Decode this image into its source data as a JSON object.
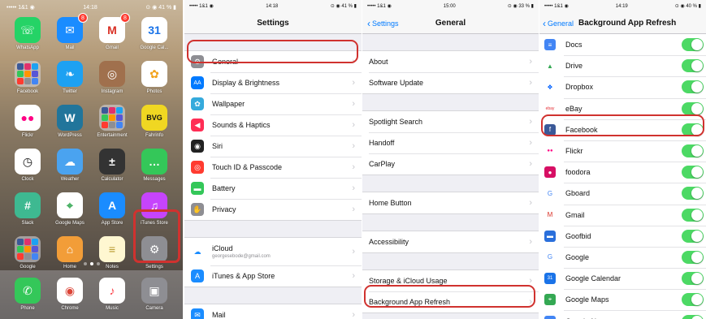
{
  "home": {
    "status": {
      "carrier": "••••• 1&1 ◉",
      "time": "14:18",
      "battery": "⊙ ◉ 41 % ▮"
    },
    "apps": [
      {
        "label": "WhatsApp",
        "icon": "whatsapp-icon",
        "color": "#25d366",
        "glyph": "☏"
      },
      {
        "label": "Mail",
        "icon": "mail-icon",
        "color": "#1a8cff",
        "glyph": "✉",
        "badge": "8"
      },
      {
        "label": "Gmail",
        "icon": "gmail-icon",
        "color": "#ffffff",
        "glyph": "M",
        "badge": "8",
        "fg": "#d93025"
      },
      {
        "label": "Google Cal...",
        "icon": "google-calendar-icon",
        "color": "#ffffff",
        "glyph": "31",
        "fg": "#1a73e8"
      },
      {
        "label": "Facebook",
        "icon": "facebook-folder-icon",
        "folder": true
      },
      {
        "label": "Twitter",
        "icon": "twitter-icon",
        "color": "#1da1f2",
        "glyph": "❧"
      },
      {
        "label": "Instagram",
        "icon": "instagram-icon",
        "color": "#a0704d",
        "glyph": "◎"
      },
      {
        "label": "Photos",
        "icon": "photos-icon",
        "color": "#ffffff",
        "glyph": "✿",
        "fg": "#f2a21a"
      },
      {
        "label": "Flickr",
        "icon": "flickr-icon",
        "color": "#ffffff",
        "glyph": "●●",
        "fg": "#ff0084"
      },
      {
        "label": "WordPress",
        "icon": "wordpress-icon",
        "color": "#21759b",
        "glyph": "W"
      },
      {
        "label": "Entertainment",
        "icon": "entertainment-folder-icon",
        "folder": true
      },
      {
        "label": "Fahrinfo",
        "icon": "bvg-icon",
        "color": "#f0d722",
        "glyph": "BVG",
        "fg": "#111111"
      },
      {
        "label": "Clock",
        "icon": "clock-icon",
        "color": "#ffffff",
        "glyph": "◷",
        "fg": "#111111"
      },
      {
        "label": "Weather",
        "icon": "weather-icon",
        "color": "#4aa3f0",
        "glyph": "☁"
      },
      {
        "label": "Calculator",
        "icon": "calculator-icon",
        "color": "#333333",
        "glyph": "±"
      },
      {
        "label": "Messages",
        "icon": "messages-icon",
        "color": "#34c759",
        "glyph": "…"
      },
      {
        "label": "Slack",
        "icon": "slack-icon",
        "color": "#3eb991",
        "glyph": "#"
      },
      {
        "label": "Google Maps",
        "icon": "google-maps-icon",
        "color": "#ffffff",
        "glyph": "⌖",
        "fg": "#34a853"
      },
      {
        "label": "App Store",
        "icon": "app-store-icon",
        "color": "#1a8cff",
        "glyph": "A"
      },
      {
        "label": "iTunes Store",
        "icon": "itunes-store-icon",
        "color": "#c644fc",
        "glyph": "♫"
      },
      {
        "label": "Google",
        "icon": "google-folder-icon",
        "folder": true
      },
      {
        "label": "Home",
        "icon": "home-icon",
        "color": "#f29d38",
        "glyph": "⌂"
      },
      {
        "label": "Notes",
        "icon": "notes-icon",
        "color": "#fff7d1",
        "glyph": "≡",
        "fg": "#b89a2e"
      },
      {
        "label": "Settings",
        "icon": "settings-icon",
        "color": "#8e8e93",
        "glyph": "⚙"
      }
    ],
    "dock": [
      {
        "label": "Phone",
        "icon": "phone-icon",
        "color": "#34c759",
        "glyph": "✆"
      },
      {
        "label": "Chrome",
        "icon": "chrome-icon",
        "color": "#ffffff",
        "glyph": "◉",
        "fg": "#db4437"
      },
      {
        "label": "Music",
        "icon": "music-icon",
        "color": "#ffffff",
        "glyph": "♪",
        "fg": "#fc3c44"
      },
      {
        "label": "Camera",
        "icon": "camera-icon",
        "color": "#8e8e93",
        "glyph": "▣"
      }
    ]
  },
  "settings": {
    "status": {
      "carrier": "••••• 1&1 ◉",
      "time": "14:18",
      "battery": "⊙ ◉ 41 % ▮"
    },
    "title": "Settings",
    "groups": [
      [
        {
          "label": "General",
          "icon": "gear-icon",
          "color": "#8e8e93",
          "glyph": "⚙"
        },
        {
          "label": "Display & Brightness",
          "icon": "display-icon",
          "color": "#007aff",
          "glyph": "AA"
        },
        {
          "label": "Wallpaper",
          "icon": "wallpaper-icon",
          "color": "#35aadc",
          "glyph": "✿"
        },
        {
          "label": "Sounds & Haptics",
          "icon": "sounds-icon",
          "color": "#ff2d55",
          "glyph": "◀"
        },
        {
          "label": "Siri",
          "icon": "siri-icon",
          "color": "#222222",
          "glyph": "◉"
        },
        {
          "label": "Touch ID & Passcode",
          "icon": "touch-id-icon",
          "color": "#ff3b30",
          "glyph": "◎"
        },
        {
          "label": "Battery",
          "icon": "battery-icon",
          "color": "#34c759",
          "glyph": "▬"
        },
        {
          "label": "Privacy",
          "icon": "privacy-icon",
          "color": "#8e8e93",
          "glyph": "✋"
        }
      ],
      [
        {
          "label": "iCloud",
          "sub": "georgesebode@gmail.com",
          "icon": "icloud-icon",
          "color": "#ffffff",
          "glyph": "☁",
          "fg": "#1a8cff"
        },
        {
          "label": "iTunes & App Store",
          "icon": "app-store-icon",
          "color": "#1a8cff",
          "glyph": "A"
        }
      ],
      [
        {
          "label": "Mail",
          "icon": "mail-icon",
          "color": "#1a8cff",
          "glyph": "✉"
        }
      ]
    ]
  },
  "general": {
    "status": {
      "carrier": "••••• 1&1 ◉",
      "time": "15:00",
      "battery": "⊙ ◉ 33 % ▮"
    },
    "back": "Settings",
    "title": "General",
    "groups": [
      [
        "About",
        "Software Update"
      ],
      [
        "Spotlight Search",
        "Handoff",
        "CarPlay"
      ],
      [
        "Home Button"
      ],
      [
        "Accessibility"
      ],
      [
        "Storage & iCloud Usage",
        "Background App Refresh"
      ]
    ]
  },
  "refresh": {
    "status": {
      "carrier": "••••• 1&1 ◉",
      "time": "14:19",
      "battery": "⊙ ◉ 40 % ▮"
    },
    "back": "General",
    "title": "Background App Refresh",
    "apps": [
      {
        "label": "Docs",
        "icon": "docs-icon",
        "color": "#4285f4",
        "glyph": "≡"
      },
      {
        "label": "Drive",
        "icon": "drive-icon",
        "color": "#ffffff",
        "glyph": "▲",
        "fg": "#34a853"
      },
      {
        "label": "Dropbox",
        "icon": "dropbox-icon",
        "color": "#ffffff",
        "glyph": "❖",
        "fg": "#0061ff"
      },
      {
        "label": "eBay",
        "icon": "ebay-icon",
        "color": "#ffffff",
        "glyph": "ebay",
        "fg": "#e53238"
      },
      {
        "label": "Facebook",
        "icon": "facebook-icon",
        "color": "#3b5998",
        "glyph": "f"
      },
      {
        "label": "Flickr",
        "icon": "flickr-icon",
        "color": "#ffffff",
        "glyph": "●●",
        "fg": "#ff0084"
      },
      {
        "label": "foodora",
        "icon": "foodora-icon",
        "color": "#d70f64",
        "glyph": "●"
      },
      {
        "label": "Gboard",
        "icon": "gboard-icon",
        "color": "#ffffff",
        "glyph": "G",
        "fg": "#4285f4"
      },
      {
        "label": "Gmail",
        "icon": "gmail-icon",
        "color": "#ffffff",
        "glyph": "M",
        "fg": "#d93025"
      },
      {
        "label": "Goofbid",
        "icon": "goofbid-icon",
        "color": "#2a6fdb",
        "glyph": "▬"
      },
      {
        "label": "Google",
        "icon": "google-icon",
        "color": "#ffffff",
        "glyph": "G",
        "fg": "#4285f4"
      },
      {
        "label": "Google Calendar",
        "icon": "google-calendar-icon",
        "color": "#1a73e8",
        "glyph": "31"
      },
      {
        "label": "Google Maps",
        "icon": "google-maps-icon",
        "color": "#34a853",
        "glyph": "⌖"
      },
      {
        "label": "Google News",
        "icon": "google-news-icon",
        "color": "#4285f4",
        "glyph": "≡"
      }
    ]
  }
}
